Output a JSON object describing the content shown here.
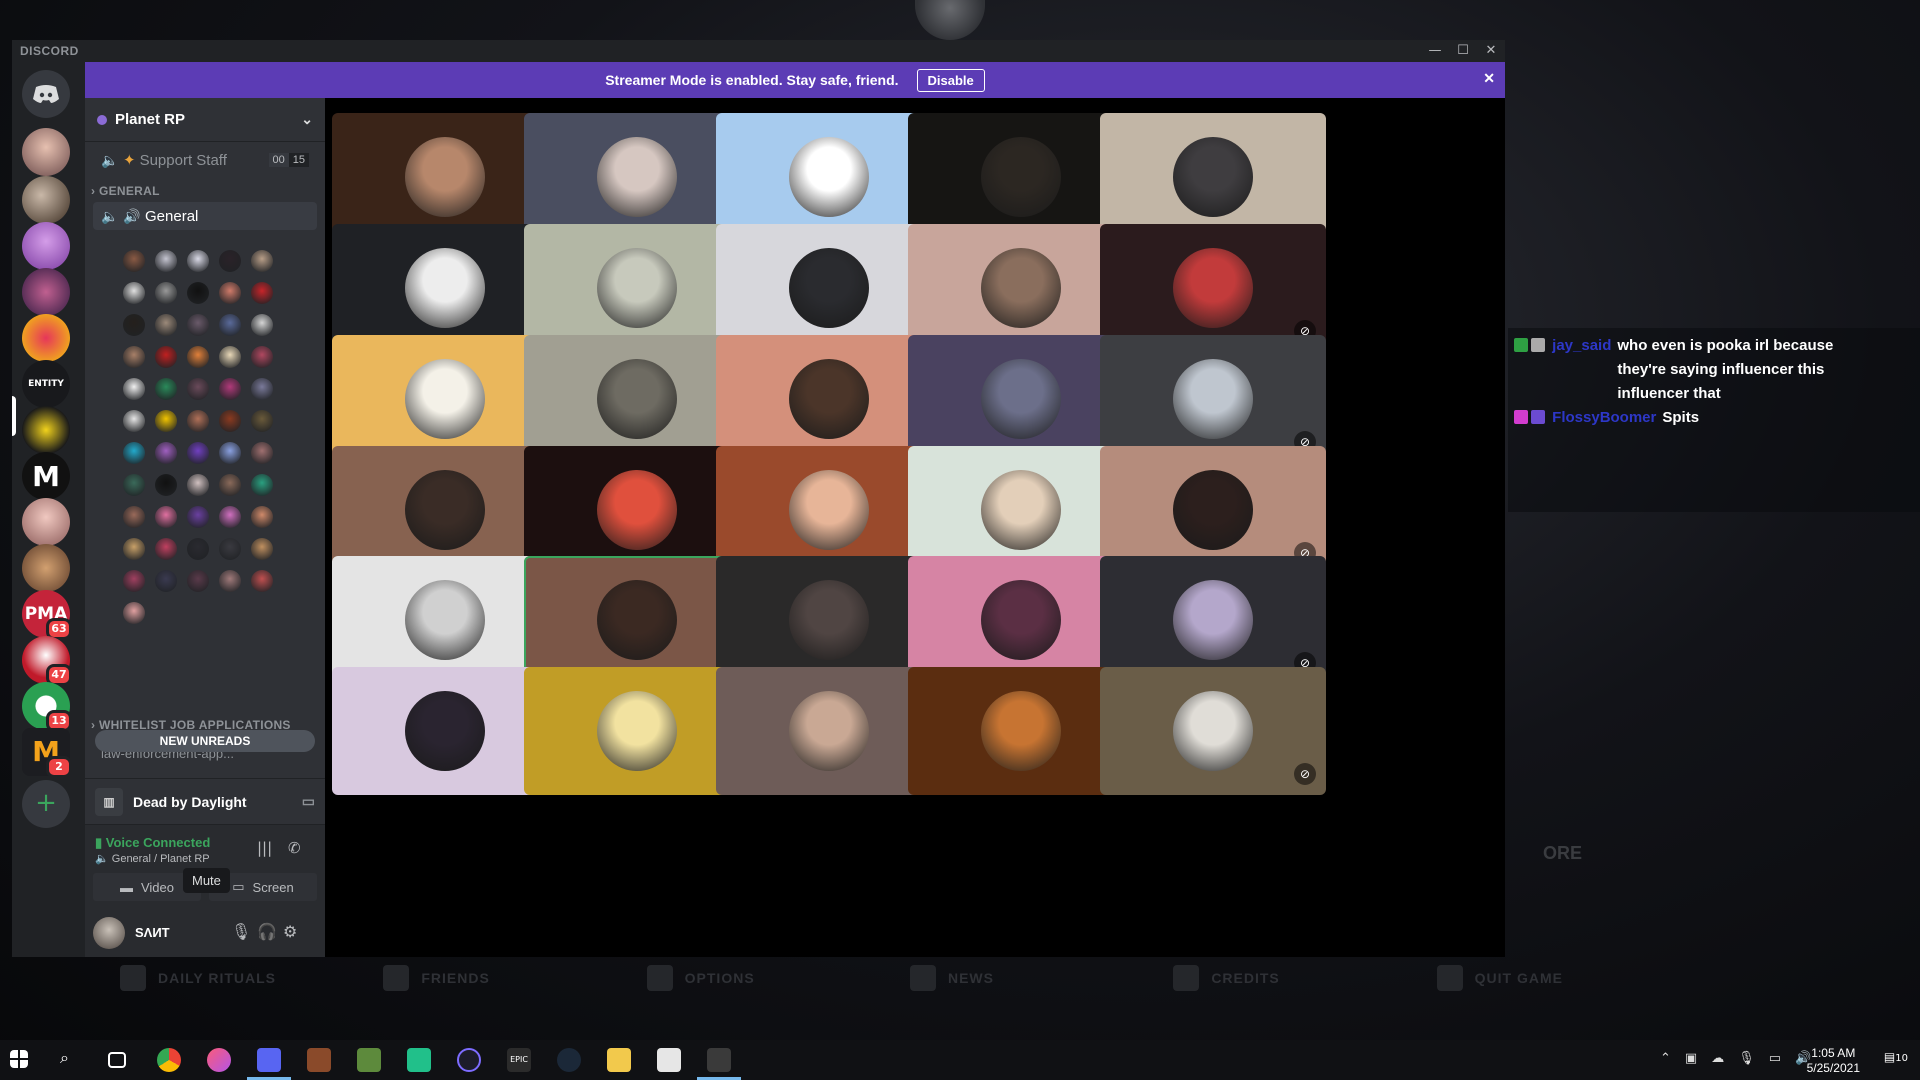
{
  "discord": {
    "wordmark": "DISCORD",
    "banner": {
      "text": "Streamer Mode is enabled. Stay safe, friend.",
      "button": "Disable"
    },
    "server_name": "Planet RP",
    "channels": {
      "support_staff": {
        "label": "Support Staff",
        "count_a": "00",
        "count_b": "15"
      },
      "category_general": "GENERAL",
      "general": "General",
      "category_whitelist": "WHITELIST JOB APPLICATIONS",
      "law_enforcement": "law-enforcement-app..."
    },
    "new_unreads": "NEW UNREADS",
    "activity": "Dead by Daylight",
    "voice": {
      "status": "Voice Connected",
      "sub": "General / Planet RP",
      "video_btn": "Video",
      "screen_btn": "Screen"
    },
    "user": {
      "name": "SΛИT"
    },
    "tooltip": "Mute",
    "server_badges": [
      "63",
      "47",
      "13",
      "2"
    ],
    "entity_label": "ENTITY",
    "pma_label": "PMA"
  },
  "tiles": [
    {
      "bg": "#3a2418",
      "face": "#b7876b",
      "muted": true
    },
    {
      "bg": "#4a4e60",
      "face": "#d6c7c1",
      "muted": true
    },
    {
      "bg": "#a7cbee",
      "face": "#ffffff",
      "muted": false
    },
    {
      "bg": "#161513",
      "face": "#2c2722",
      "muted": true
    },
    {
      "bg": "#c2b6a6",
      "face": "#3f3d40",
      "muted": false
    },
    {
      "bg": "#1f2125",
      "face": "#ededed",
      "muted": true
    },
    {
      "bg": "#b3b7a5",
      "face": "#c7c9bc",
      "muted": true
    },
    {
      "bg": "#d7d7dc",
      "face": "#2a2b2f",
      "muted": true
    },
    {
      "bg": "#c8a59b",
      "face": "#8a6e5d",
      "muted": false
    },
    {
      "bg": "#2b1b1d",
      "face": "#c23b3b",
      "muted": true
    },
    {
      "bg": "#eab75c",
      "face": "#f4f1e8",
      "muted": true
    },
    {
      "bg": "#a19f92",
      "face": "#6e6b62",
      "muted": false
    },
    {
      "bg": "#d4907b",
      "face": "#4b3529",
      "muted": true
    },
    {
      "bg": "#4a4260",
      "face": "#6c6f8a",
      "muted": true
    },
    {
      "bg": "#3d3e42",
      "face": "#bfc6cf",
      "muted": true
    },
    {
      "bg": "#876250",
      "face": "#3a2c26",
      "muted": false
    },
    {
      "bg": "#1c0f0f",
      "face": "#e0503d",
      "muted": true
    },
    {
      "bg": "#9a4a2c",
      "face": "#e7b598",
      "muted": false
    },
    {
      "bg": "#d8e3da",
      "face": "#e3cfb9",
      "muted": false
    },
    {
      "bg": "#b58c7c",
      "face": "#2c1f1d",
      "muted": true
    },
    {
      "bg": "#e4e4e4",
      "face": "#d0d0d0",
      "muted": true
    },
    {
      "bg": "#7b5647",
      "face": "#3b2922",
      "muted": false,
      "speaking": true
    },
    {
      "bg": "#2a2929",
      "face": "#504543",
      "muted": true
    },
    {
      "bg": "#d684a4",
      "face": "#5b2f44",
      "muted": true
    },
    {
      "bg": "#2d2d33",
      "face": "#b4a7cb",
      "muted": true
    },
    {
      "bg": "#d8c9df",
      "face": "#2a2430",
      "muted": true
    },
    {
      "bg": "#c19d26",
      "face": "#f2e2a0",
      "muted": true
    },
    {
      "bg": "#6e5c58",
      "face": "#c9a894",
      "muted": false
    },
    {
      "bg": "#5b2d10",
      "face": "#c77432",
      "muted": false
    },
    {
      "bg": "#6a5d48",
      "face": "#e0ddd7",
      "muted": true
    }
  ],
  "chat": [
    {
      "badge_color": "#2ea043",
      "user": "jay_said",
      "text": "who even is pooka irl because they're saying influencer this influencer that"
    },
    {
      "badge_color": "#d23cce",
      "user": "FlossyBoomer",
      "text": "Spits"
    }
  ],
  "game_menu": [
    "DAILY RITUALS",
    "FRIENDS",
    "OPTIONS",
    "NEWS",
    "CREDITS",
    "QUIT GAME"
  ],
  "game_overlay_text": "ORE",
  "taskbar": {
    "time": "1:05 AM",
    "date": "5/25/2021",
    "notif": "10"
  }
}
